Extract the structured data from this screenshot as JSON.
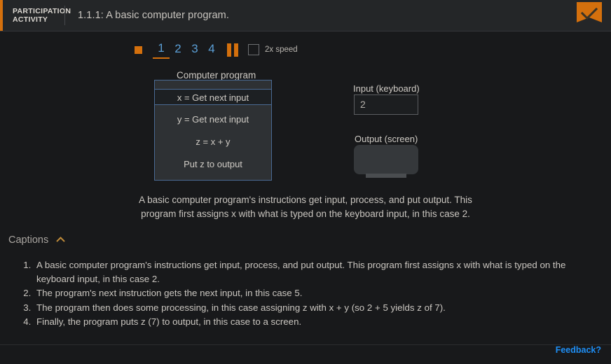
{
  "header": {
    "badge_label": "PARTICIPATION\nACTIVITY",
    "title": "1.1.1: A basic computer program.",
    "check_icon": "check-banner-icon",
    "accent_color": "#d4700d"
  },
  "stepbar": {
    "marker_icon": "square-marker-icon",
    "steps": [
      {
        "label": "1",
        "active": true
      },
      {
        "label": "2",
        "active": false
      },
      {
        "label": "3",
        "active": false
      },
      {
        "label": "4",
        "active": false
      }
    ],
    "pause_icon": "pause-icon",
    "speed_checked": false,
    "speed_label": "2x speed",
    "link_color": "#5b9fd6"
  },
  "animation": {
    "program_title": "Computer program",
    "program_lines": [
      "x = Get next input",
      "y = Get next input",
      "z = x + y",
      "Put z to output"
    ],
    "highlighted_line_index": 0,
    "input_label": "Input (keyboard)",
    "input_value": "2",
    "output_label": "Output (screen)",
    "output_value": ""
  },
  "explanation": "A basic computer program's instructions get input, process, and put output.  This program first assigns x with what is typed on the keyboard input, in this case 2.",
  "captions": {
    "title": "Captions",
    "toggle_icon": "chevron-up-icon",
    "expanded": true,
    "items": [
      "A basic computer program's instructions get input, process, and put output. This program first assigns x with what is typed on the keyboard input, in this case 2.",
      "The program's next instruction gets the next input, in this case 5.",
      "The program then does some processing, in this case assigning z with x + y (so 2 + 5 yields z of 7).",
      "Finally, the program puts z (7) to output, in this case to a screen."
    ]
  },
  "footer": {
    "feedback_label": "Feedback?",
    "feedback_color": "#1e8ef5"
  }
}
